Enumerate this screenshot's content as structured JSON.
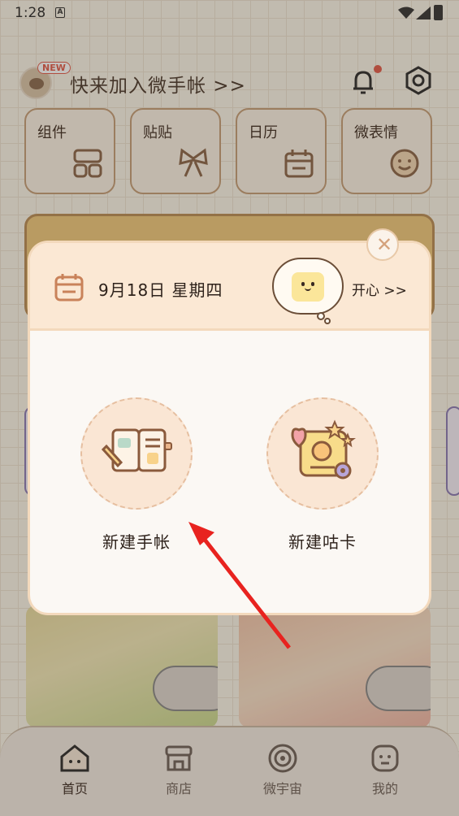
{
  "status_bar": {
    "time": "1:28"
  },
  "header": {
    "new_badge": "NEW",
    "join_text": "快来加入微手帐 >>"
  },
  "tools": [
    {
      "label": "组件",
      "icon": "widget-icon"
    },
    {
      "label": "贴贴",
      "icon": "bow-icon"
    },
    {
      "label": "日历",
      "icon": "calendar-icon"
    },
    {
      "label": "微表情",
      "icon": "smiley-icon"
    }
  ],
  "modal": {
    "date": "9月18日 星期四",
    "mood": "开心 >>",
    "options": [
      {
        "label": "新建手帐",
        "icon": "notebook-icon"
      },
      {
        "label": "新建咕卡",
        "icon": "guka-card-icon"
      }
    ]
  },
  "tabbar": [
    {
      "label": "首页",
      "icon": "home-icon",
      "active": true
    },
    {
      "label": "商店",
      "icon": "store-icon",
      "active": false
    },
    {
      "label": "微宇宙",
      "icon": "universe-icon",
      "active": false
    },
    {
      "label": "我的",
      "icon": "profile-icon",
      "active": false
    }
  ],
  "colors": {
    "accent": "#e25b4a",
    "arrow": "#e8231f",
    "brown": "#c59e77"
  }
}
